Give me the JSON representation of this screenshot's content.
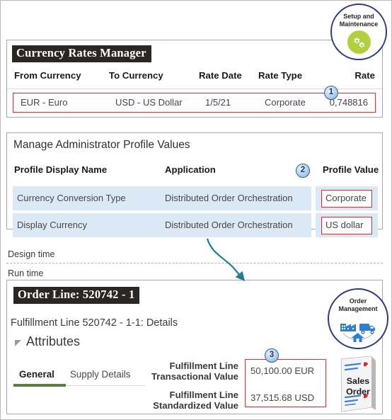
{
  "currency_panel": {
    "title": "Currency Rates Manager",
    "columns": [
      "From Currency",
      "To Currency",
      "Rate Date",
      "Rate Type",
      "Rate"
    ],
    "row": {
      "from_currency": "EUR - Euro",
      "to_currency": "USD - US Dollar",
      "rate_date": "1/5/21",
      "rate_type": "Corporate",
      "rate": "0,748816"
    }
  },
  "profile_panel": {
    "title": "Manage Administrator Profile Values",
    "columns": [
      "Profile Display Name",
      "Application",
      "Profile Value"
    ],
    "rows": [
      {
        "profile_display_name": "Currency Conversion Type",
        "application": "Distributed Order Orchestration",
        "profile_value": "Corporate"
      },
      {
        "profile_display_name": "Display Currency",
        "application": "Distributed Order Orchestration",
        "profile_value": "US dollar"
      }
    ]
  },
  "divider": {
    "design_time": "Design time",
    "run_time": "Run time"
  },
  "order_panel": {
    "title": "Order Line: 520742 - 1",
    "fulfillment_line": "Fulfillment Line 520742 - 1-1: Details",
    "attributes_label": "Attributes",
    "tabs": [
      {
        "label": "General",
        "active": true
      },
      {
        "label": "Supply Details",
        "active": false
      }
    ],
    "fulfillment_values": [
      {
        "label_line1": "Fulfillment Line",
        "label_line2": "Transactional Value",
        "value": "50,100.00 EUR"
      },
      {
        "label_line1": "Fulfillment Line",
        "label_line2": "Standardized Value",
        "value": "37,515.68 USD"
      }
    ]
  },
  "callouts": [
    {
      "number": "1"
    },
    {
      "number": "2"
    },
    {
      "number": "3"
    }
  ],
  "badges": {
    "setup": {
      "line1": "Setup and",
      "line2": "Maintenance",
      "icon": "gears-icon"
    },
    "order": {
      "line1": "Order",
      "line2": "Management",
      "icon": "supply-chain-icon"
    },
    "sales_order": {
      "line1": "Sales",
      "line2": "Order",
      "icon": "document-icon"
    }
  },
  "colors": {
    "highlight_red": "#ee2a24",
    "row_blue": "#dbe9f6",
    "badge_navy": "#2b3c8c",
    "gear_green": "#b2cf3f",
    "tab_green": "#5a7a46",
    "arrow_teal": "#1f7f98",
    "title_dark": "#2b2523"
  }
}
